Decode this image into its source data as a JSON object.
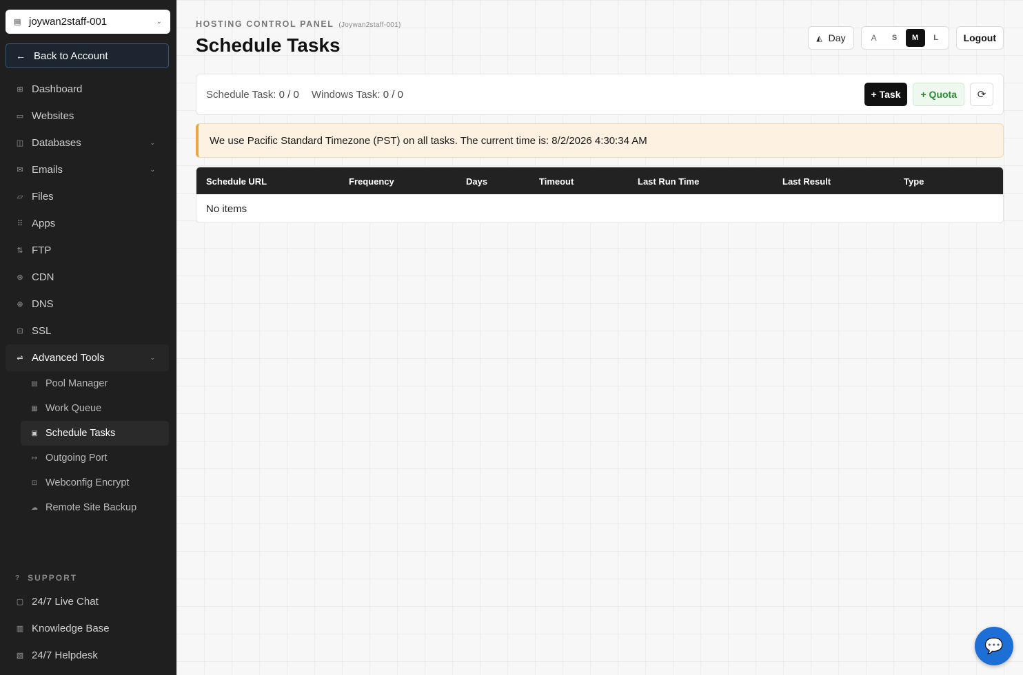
{
  "sidebar": {
    "account": "joywan2staff-001",
    "back_label": "Back to Account",
    "items": [
      {
        "label": "Dashboard",
        "icon": "grid-icon"
      },
      {
        "label": "Websites",
        "icon": "browser-icon"
      },
      {
        "label": "Databases",
        "icon": "database-icon"
      },
      {
        "label": "Emails",
        "icon": "mail-icon"
      },
      {
        "label": "Files",
        "icon": "folder-icon"
      },
      {
        "label": "Apps",
        "icon": "apps-icon"
      },
      {
        "label": "FTP",
        "icon": "ftp-icon"
      },
      {
        "label": "CDN",
        "icon": "cdn-icon"
      },
      {
        "label": "DNS",
        "icon": "globe-icon"
      },
      {
        "label": "SSL",
        "icon": "lock-icon"
      },
      {
        "label": "Advanced Tools",
        "icon": "sliders-icon"
      }
    ],
    "sub_items": [
      {
        "label": "Pool Manager",
        "icon": "server-icon"
      },
      {
        "label": "Work Queue",
        "icon": "queue-icon"
      },
      {
        "label": "Schedule Tasks",
        "icon": "calendar-icon"
      },
      {
        "label": "Outgoing Port",
        "icon": "port-icon"
      },
      {
        "label": "Webconfig Encrypt",
        "icon": "lock-icon"
      },
      {
        "label": "Remote Site Backup",
        "icon": "cloud-icon"
      }
    ],
    "support_title": "SUPPORT",
    "support_items": [
      {
        "label": "24/7 Live Chat",
        "icon": "chat-icon"
      },
      {
        "label": "Knowledge Base",
        "icon": "book-icon"
      },
      {
        "label": "24/7 Helpdesk",
        "icon": "ticket-icon"
      }
    ]
  },
  "header": {
    "panel_label": "HOSTING CONTROL PANEL",
    "account_tag": "(Joywan2staff-001)",
    "title": "Schedule Tasks",
    "day_label": "Day",
    "sizes": [
      "S",
      "M",
      "L"
    ],
    "selected_size": "M",
    "logout_label": "Logout"
  },
  "stats": {
    "schedule_label": "Schedule Task:",
    "schedule_value": "0 / 0",
    "windows_label": "Windows Task:",
    "windows_value": "0 / 0",
    "task_btn": "+ Task",
    "quota_btn": "+ Quota"
  },
  "notice": "We use Pacific Standard Timezone (PST) on all tasks. The current time is: 8/2/2026 4:30:34 AM",
  "table": {
    "columns": [
      "Schedule URL",
      "Frequency",
      "Days",
      "Timeout",
      "Last Run Time",
      "Last Result",
      "Type"
    ],
    "empty_text": "No items"
  },
  "colors": {
    "sidebar_bg": "#1f1f1f",
    "accent_dark": "#111111",
    "quota_green": "#2e8b3a",
    "notice_border": "#e8a94a",
    "chat_blue": "#1d6fd6"
  }
}
